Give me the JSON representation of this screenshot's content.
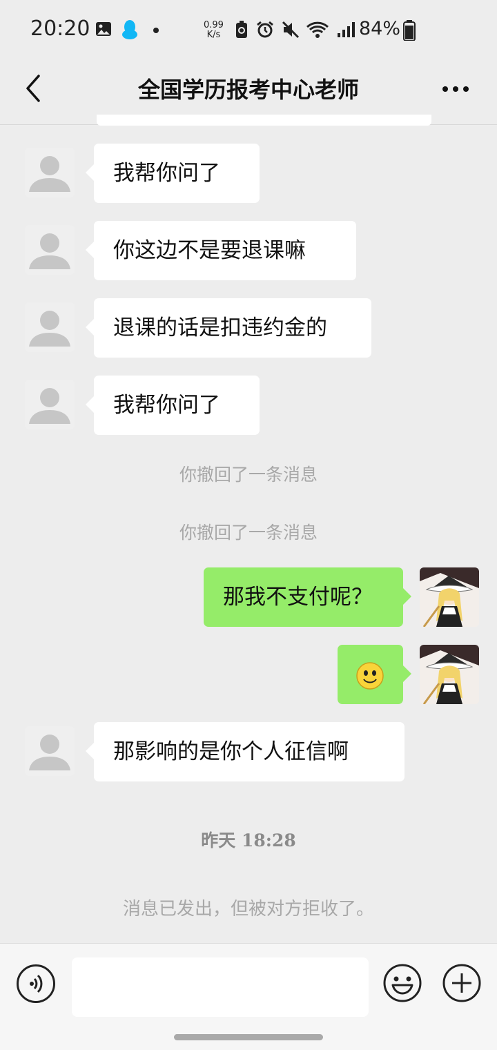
{
  "status_bar": {
    "time": "20:20",
    "net_speed_value": "0.99",
    "net_speed_unit": "K/s",
    "battery": "84%"
  },
  "header": {
    "title": "全国学历报考中心老师"
  },
  "messages": [
    {
      "side": "in",
      "text": "我帮你问了"
    },
    {
      "side": "in",
      "text": "你这边不是要退课嘛"
    },
    {
      "side": "in",
      "text": "退课的话是扣违约金的"
    },
    {
      "side": "in",
      "text": "我帮你问了"
    },
    {
      "side": "out",
      "text": "那我不支付呢？"
    },
    {
      "side": "out",
      "text": ""
    },
    {
      "side": "in",
      "text": "那影响的是你个人征信啊"
    }
  ],
  "system": {
    "recall_1": "你撤回了一条消息",
    "recall_2": "你撤回了一条消息",
    "timestamp": "昨天 18:28",
    "rejected": "消息已发出，但被对方拒收了。"
  },
  "colors": {
    "background": "#ededed",
    "bubble_in": "#ffffff",
    "bubble_out": "#95ec69"
  },
  "icons": [
    "back-arrow-icon",
    "more-icon",
    "voice-icon",
    "emoji-icon",
    "plus-icon",
    "smiley-emoji"
  ]
}
